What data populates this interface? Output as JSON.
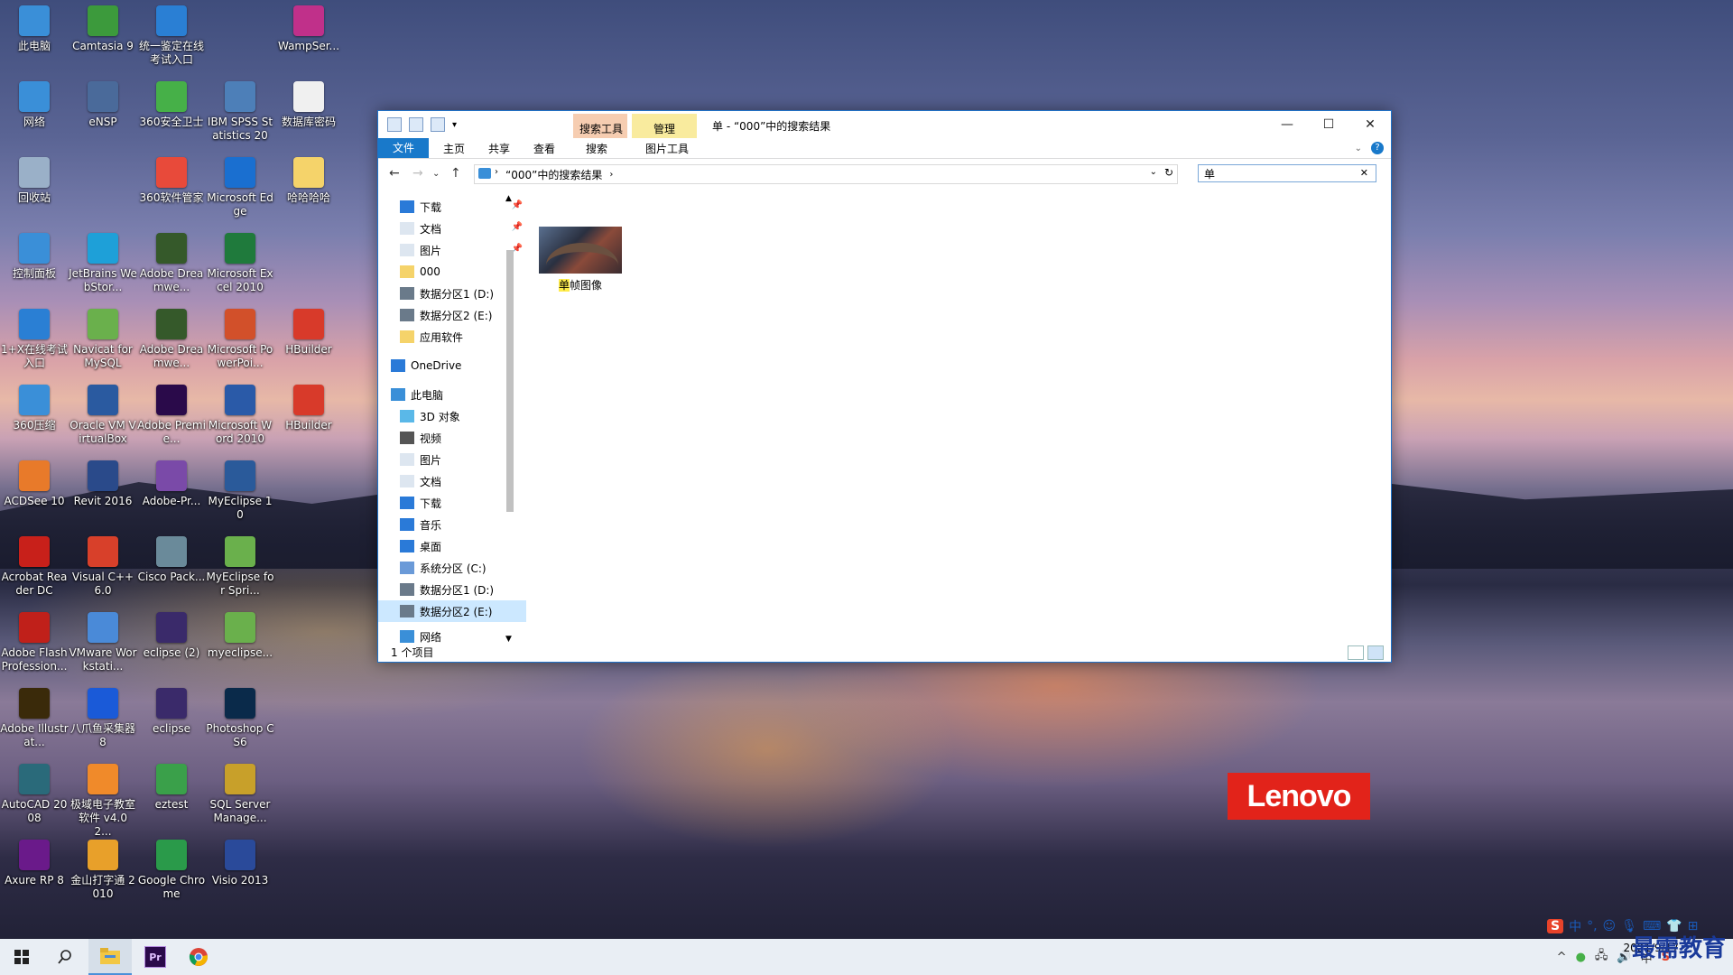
{
  "desktop_icons": [
    {
      "label": "此电脑",
      "icon": "computer-icon",
      "color": "#3a8fd8"
    },
    {
      "label": "Camtasia 9",
      "icon": "camtasia-icon",
      "color": "#3c9a3c"
    },
    {
      "label": "统一鉴定在线考试入口",
      "icon": "ie-shortcut-icon",
      "color": "#2a7fd4"
    },
    {
      "label": "WampSer...",
      "icon": "wampserver-icon",
      "color": "#c0308a"
    },
    {
      "label": "网络",
      "icon": "network-icon",
      "color": "#3a8fd8"
    },
    {
      "label": "eNSP",
      "icon": "ensp-icon",
      "color": "#4a6a9a"
    },
    {
      "label": "360安全卫士",
      "icon": "360-safe-icon",
      "color": "#46b048"
    },
    {
      "label": "IBM SPSS Statistics 20",
      "icon": "spss-icon",
      "color": "#4d7fb8"
    },
    {
      "label": "数据库密码",
      "icon": "text-file-icon",
      "color": "#f0f0f0"
    },
    {
      "label": "回收站",
      "icon": "recycle-bin-icon",
      "color": "#9ab0c8"
    },
    {
      "label": "360软件管家",
      "icon": "360-software-icon",
      "color": "#e84a3a"
    },
    {
      "label": "Microsoft Edge",
      "icon": "edge-icon",
      "color": "#1a6fd0"
    },
    {
      "label": "哈哈哈哈",
      "icon": "folder-icon",
      "color": "#f5d36a"
    },
    {
      "label": "控制面板",
      "icon": "control-panel-icon",
      "color": "#3a8fd8"
    },
    {
      "label": "JetBrains WebStor...",
      "icon": "webstorm-icon",
      "color": "#1ea0d8"
    },
    {
      "label": "Adobe Dreamwe...",
      "icon": "dreamweaver-icon",
      "color": "#35592a"
    },
    {
      "label": "Microsoft Excel 2010",
      "icon": "excel-icon",
      "color": "#1f7a3c"
    },
    {
      "label": "1+X在线考试入口",
      "icon": "ie-shortcut-icon",
      "color": "#2a7fd4"
    },
    {
      "label": "Navicat for MySQL",
      "icon": "navicat-icon",
      "color": "#6ab04c"
    },
    {
      "label": "Adobe Dreamwe...",
      "icon": "dreamweaver-icon",
      "color": "#35592a"
    },
    {
      "label": "Microsoft PowerPoi...",
      "icon": "powerpoint-icon",
      "color": "#d2502a"
    },
    {
      "label": "HBuilder",
      "icon": "hbuilder-icon",
      "color": "#d83a2a"
    },
    {
      "label": "360压缩",
      "icon": "360-zip-icon",
      "color": "#3a8fd8"
    },
    {
      "label": "Oracle VM VirtualBox",
      "icon": "virtualbox-icon",
      "color": "#2a5aa0"
    },
    {
      "label": "Adobe Premie...",
      "icon": "premiere-icon",
      "color": "#2a0a4a"
    },
    {
      "label": "Microsoft Word 2010",
      "icon": "word-icon",
      "color": "#2a5aa8"
    },
    {
      "label": "HBuilder",
      "icon": "hbuilder-icon",
      "color": "#d83a2a"
    },
    {
      "label": "ACDSee 10",
      "icon": "acdsee-icon",
      "color": "#e87a2a"
    },
    {
      "label": "Revit 2016",
      "icon": "revit-icon",
      "color": "#2a4a8a"
    },
    {
      "label": "Adobe-Pr...",
      "icon": "winrar-icon",
      "color": "#7a4aa8"
    },
    {
      "label": "MyEclipse 10",
      "icon": "myeclipse-icon",
      "color": "#2a5a9a"
    },
    {
      "label": "Acrobat Reader DC",
      "icon": "acrobat-icon",
      "color": "#c8201a"
    },
    {
      "label": "Visual C++ 6.0",
      "icon": "visual-cpp-icon",
      "color": "#d8402a"
    },
    {
      "label": "Cisco Pack...",
      "icon": "cisco-icon",
      "color": "#6a8a9a"
    },
    {
      "label": "MyEclipse for Spri...",
      "icon": "myeclipse-spring-icon",
      "color": "#6ab04c"
    },
    {
      "label": "Adobe Flash Profession...",
      "icon": "flash-icon",
      "color": "#c0201a"
    },
    {
      "label": "VMware Workstati...",
      "icon": "vmware-icon",
      "color": "#4a8ad8"
    },
    {
      "label": "eclipse (2)",
      "icon": "eclipse-icon",
      "color": "#3a2a6a"
    },
    {
      "label": "myeclipse...",
      "icon": "myeclipse-spring-icon",
      "color": "#6ab04c"
    },
    {
      "label": "Adobe Illustrat...",
      "icon": "illustrator-icon",
      "color": "#3a2a0a"
    },
    {
      "label": "八爪鱼采集器 8",
      "icon": "bazhuayu-icon",
      "color": "#1a5ad8"
    },
    {
      "label": "eclipse",
      "icon": "eclipse-icon",
      "color": "#3a2a6a"
    },
    {
      "label": "Photoshop CS6",
      "icon": "photoshop-icon",
      "color": "#0a2a4a"
    },
    {
      "label": "AutoCAD 2008",
      "icon": "autocad-icon",
      "color": "#2a6a7a"
    },
    {
      "label": "极域电子教室软件 v4.0 2...",
      "icon": "jiyu-icon",
      "color": "#f08a2a"
    },
    {
      "label": "eztest",
      "icon": "eztest-icon",
      "color": "#3aa04a"
    },
    {
      "label": "SQL Server Manage...",
      "icon": "sql-server-icon",
      "color": "#c8a02a"
    },
    {
      "label": "Axure RP 8",
      "icon": "axure-icon",
      "color": "#6a1a8a"
    },
    {
      "label": "金山打字通 2010",
      "icon": "jinshan-typing-icon",
      "color": "#e8a02a"
    },
    {
      "label": "Google Chrome",
      "icon": "chrome-icon",
      "color": "#2a9a4a"
    },
    {
      "label": "Visio 2013",
      "icon": "visio-icon",
      "color": "#2a4a9a"
    }
  ],
  "explorer": {
    "window_title": "单 - “000”中的搜索结果",
    "context_tab_search": "搜索工具",
    "context_tab_manage": "管理",
    "tabs": {
      "file": "文件",
      "home": "主页",
      "share": "共享",
      "view": "查看",
      "search": "搜索",
      "picture_tools": "图片工具"
    },
    "address_path": "“000”中的搜索结果",
    "search_query": "单",
    "nav_items": [
      {
        "label": "下载",
        "icon": "download-icon",
        "pinned": true
      },
      {
        "label": "文档",
        "icon": "documents-icon",
        "pinned": true
      },
      {
        "label": "图片",
        "icon": "pictures-icon",
        "pinned": true
      },
      {
        "label": "000",
        "icon": "folder-icon",
        "pinned": false
      },
      {
        "label": "数据分区1 (D:)",
        "icon": "drive-icon",
        "pinned": false
      },
      {
        "label": "数据分区2 (E:)",
        "icon": "drive-icon",
        "pinned": false
      },
      {
        "label": "应用软件",
        "icon": "folder-icon",
        "pinned": false
      },
      {
        "label": "OneDrive",
        "icon": "onedrive-icon",
        "pinned": false
      },
      {
        "label": "此电脑",
        "icon": "computer-icon",
        "pinned": false
      },
      {
        "label": "3D 对象",
        "icon": "3d-objects-icon",
        "pinned": false
      },
      {
        "label": "视频",
        "icon": "videos-icon",
        "pinned": false
      },
      {
        "label": "图片",
        "icon": "pictures-icon",
        "pinned": false
      },
      {
        "label": "文档",
        "icon": "documents-icon",
        "pinned": false
      },
      {
        "label": "下载",
        "icon": "download-icon",
        "pinned": false
      },
      {
        "label": "音乐",
        "icon": "music-icon",
        "pinned": false
      },
      {
        "label": "桌面",
        "icon": "desktop-icon",
        "pinned": false
      },
      {
        "label": "系统分区 (C:)",
        "icon": "system-drive-icon",
        "pinned": false
      },
      {
        "label": "数据分区1 (D:)",
        "icon": "drive-icon",
        "pinned": false
      },
      {
        "label": "数据分区2 (E:)",
        "icon": "drive-icon",
        "pinned": false
      },
      {
        "label": "网络",
        "icon": "network-icon",
        "pinned": false
      }
    ],
    "file_item": {
      "name_highlight": "单",
      "name_rest": "帧图像"
    },
    "status_text": "1 个项目"
  },
  "wallpaper_logo": "Lenovo",
  "taskbar": {
    "apps": [
      "windows-start-icon",
      "search-icon",
      "file-explorer-icon",
      "premiere-icon",
      "chrome-icon"
    ],
    "clock_time": "",
    "clock_date": "2021/9/17",
    "brand_text": "最需教育",
    "ime_text": "中"
  },
  "colors": {
    "accent": "#1979ca",
    "context_search_tab": "#f6cdb1",
    "context_manage_tab": "#f9eb9e",
    "lenovo_red": "#e2231a"
  }
}
